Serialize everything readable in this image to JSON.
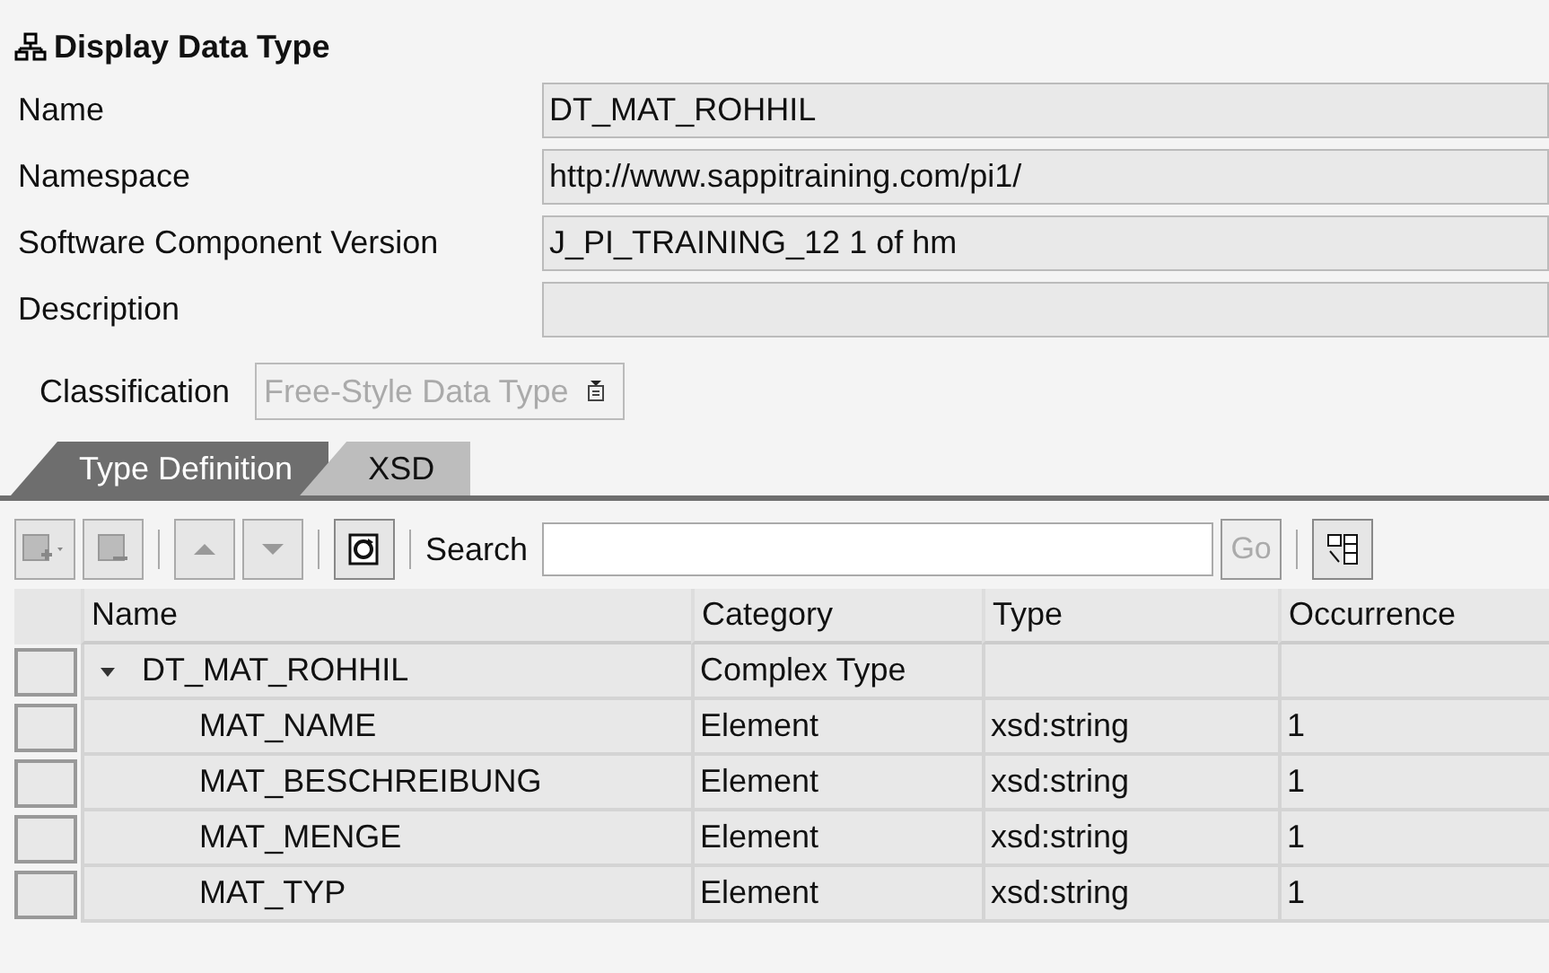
{
  "title": "Display Data Type",
  "fields": [
    {
      "label": "Name",
      "value": "DT_MAT_ROHHIL"
    },
    {
      "label": "Namespace",
      "value": "http://www.sappitraining.com/pi1/"
    },
    {
      "label": "Software Component Version",
      "value": "J_PI_TRAINING_12 1 of hm"
    },
    {
      "label": "Description"
    }
  ],
  "classification": {
    "label": "Classification",
    "value": "Free-Style Data Type",
    "disabled": true
  },
  "tabs": [
    {
      "label": "Type Definition",
      "selected": true
    },
    {
      "label": "XSD",
      "selected": false
    }
  ],
  "toolbar": {
    "add_disabled": true,
    "remove_disabled": true,
    "up_disabled": true,
    "down_disabled": true,
    "search_label": "Search",
    "go": {
      "label": "Go",
      "disabled": true
    }
  },
  "table": {
    "columns": [
      "Name",
      "Category",
      "Type",
      "Occurrence"
    ],
    "rows": [
      {
        "name": "DT_MAT_ROHHIL",
        "category": "Complex Type",
        "expanded": true,
        "children": [
          {
            "name": "MAT_NAME",
            "category": "Element",
            "type": "xsd:string",
            "occurrence": "1"
          },
          {
            "name": "MAT_BESCHREIBUNG",
            "category": "Element",
            "type": "xsd:string",
            "occurrence": "1"
          },
          {
            "name": "MAT_MENGE",
            "category": "Element",
            "type": "xsd:string",
            "occurrence": "1"
          },
          {
            "name": "MAT_TYP",
            "category": "Element",
            "type": "xsd:string",
            "occurrence": "1"
          }
        ]
      }
    ]
  }
}
